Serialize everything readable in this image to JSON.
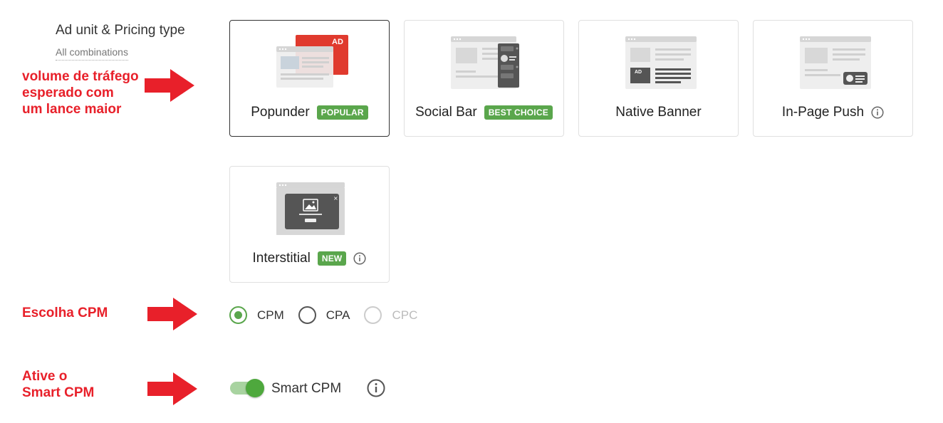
{
  "section": {
    "title": "Ad unit & Pricing type",
    "subtitle": "All combinations"
  },
  "annotations": {
    "traffic": [
      "volume de tráfego",
      "esperado com",
      "um lance maior"
    ],
    "cpm": "Escolha CPM",
    "smart": [
      "Ative o",
      "Smart CPM"
    ],
    "color": "#e8202a"
  },
  "ad_units": [
    {
      "name": "Popunder",
      "badge": "POPULAR",
      "selected": true
    },
    {
      "name": "Social Bar",
      "badge": "BEST CHOICE",
      "selected": false
    },
    {
      "name": "Native Banner",
      "badge": "",
      "selected": false
    },
    {
      "name": "In-Page Push",
      "badge": "",
      "info": true,
      "selected": false
    },
    {
      "name": "Interstitial",
      "badge": "NEW",
      "info": true,
      "selected": false
    }
  ],
  "illustration_text": {
    "popunder_ad": "AD",
    "native_ad": "AD"
  },
  "pricing": {
    "options": [
      "CPM",
      "CPA",
      "CPC"
    ],
    "selected": "CPM",
    "disabled": [
      "CPC"
    ]
  },
  "smart_cpm": {
    "label": "Smart CPM",
    "enabled": true
  },
  "colors": {
    "accent_green": "#5aa64c",
    "selected_border": "#333333",
    "annotation_red": "#e8202a"
  }
}
